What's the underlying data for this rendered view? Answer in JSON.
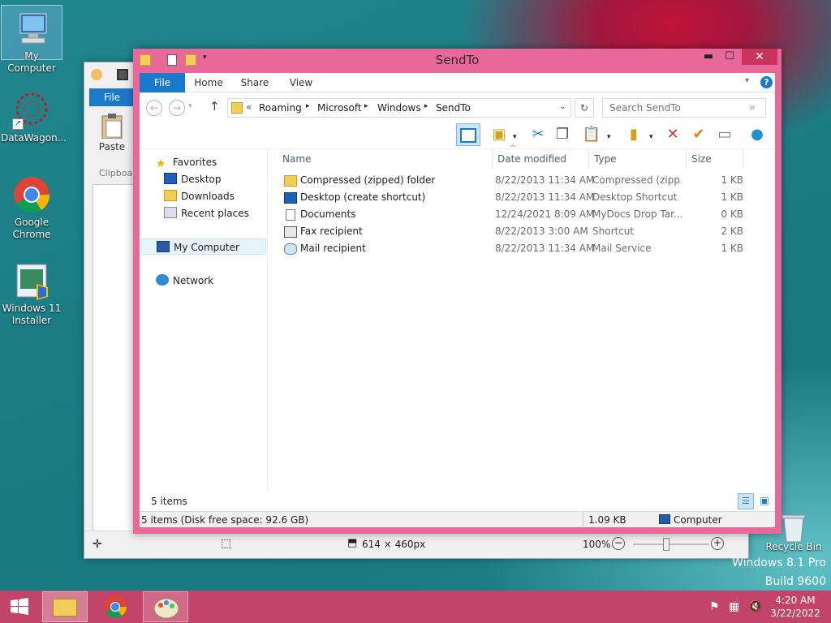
{
  "desktop": {
    "icons": [
      {
        "label": "My Computer"
      },
      {
        "label": "DataWagon..."
      },
      {
        "label": "Google Chrome"
      },
      {
        "label": "Windows 11 Installer"
      },
      {
        "label": "Recycle Bin"
      }
    ],
    "watermark": {
      "line1": "Windows 8.1 Pro",
      "line2": "Build 9600"
    }
  },
  "paint": {
    "file_tab": "File",
    "paste": "Paste",
    "clipboard": "Clipboa",
    "size_text": "614 × 460px",
    "zoom_text": "100%"
  },
  "explorer": {
    "title": "SendTo",
    "ribbon_tabs": [
      "File",
      "Home",
      "Share",
      "View"
    ],
    "breadcrumb": [
      "Roaming",
      "Microsoft",
      "Windows",
      "SendTo"
    ],
    "search_placeholder": "Search SendTo",
    "nav": {
      "favorites": "Favorites",
      "desktop": "Desktop",
      "downloads": "Downloads",
      "recent": "Recent places",
      "computer": "My Computer",
      "network": "Network"
    },
    "columns": [
      "Name",
      "Date modified",
      "Type",
      "Size"
    ],
    "files": [
      {
        "name": "Compressed (zipped) folder",
        "date": "8/22/2013 11:34 AM",
        "type": "Compressed (zipp...",
        "size": "1 KB"
      },
      {
        "name": "Desktop (create shortcut)",
        "date": "8/22/2013 11:34 AM",
        "type": "Desktop Shortcut",
        "size": "1 KB"
      },
      {
        "name": "Documents",
        "date": "12/24/2021 8:09 AM",
        "type": "MyDocs Drop Tar...",
        "size": "0 KB"
      },
      {
        "name": "Fax recipient",
        "date": "8/22/2013 3:00 AM",
        "type": "Shortcut",
        "size": "2 KB"
      },
      {
        "name": "Mail recipient",
        "date": "8/22/2013 11:34 AM",
        "type": "Mail Service",
        "size": "1 KB"
      }
    ],
    "item_count": "5 items",
    "status_left": "5 items (Disk free space: 92.6 GB)",
    "status_size": "1.09 KB",
    "status_location": "Computer"
  },
  "clock": {
    "time": "4:20 AM",
    "date": "3/22/2022"
  },
  "colors": {
    "accent": "#1979ca",
    "window_frame": "#e8689a",
    "taskbar": "#c3446a"
  }
}
